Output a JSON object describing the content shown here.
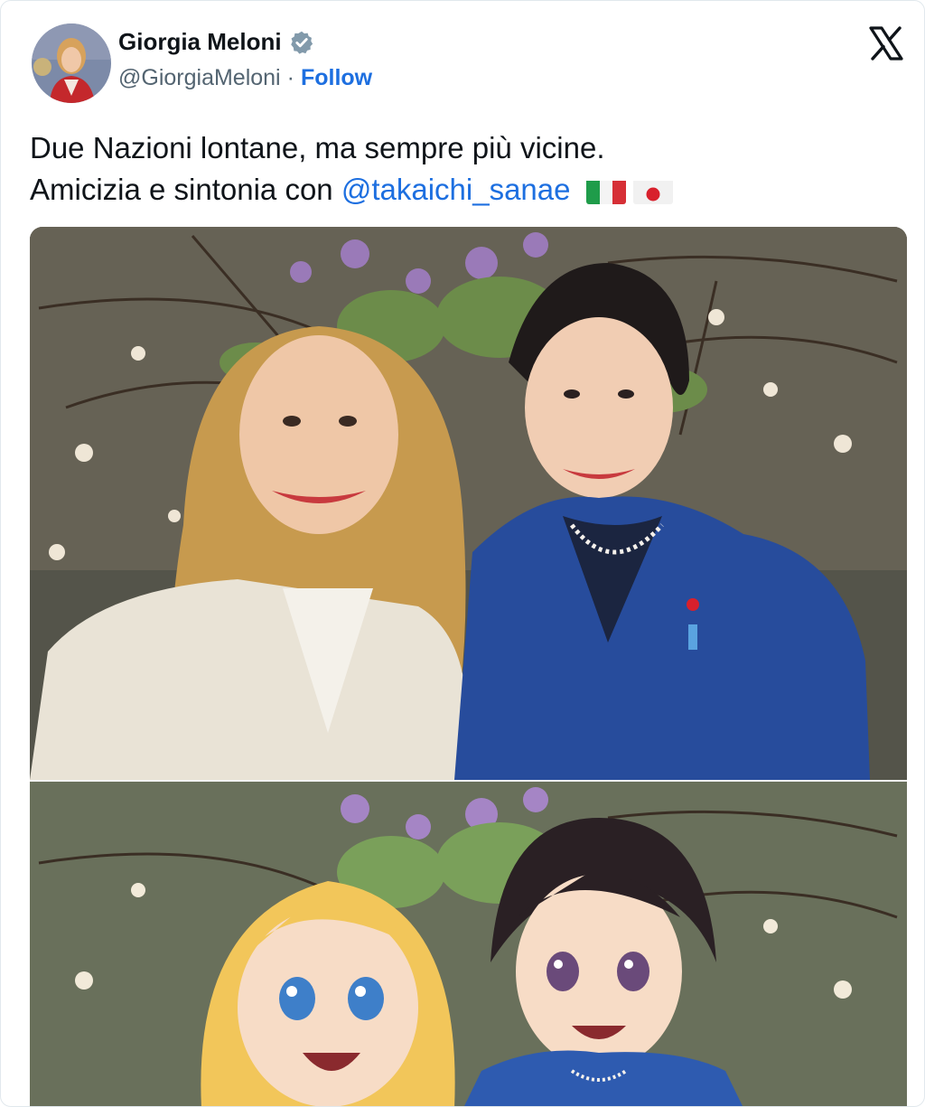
{
  "author": {
    "name": "Giorgia Meloni",
    "handle": "@GiorgiaMeloni",
    "separator": "·",
    "follow_label": "Follow"
  },
  "icons": {
    "verified": "verified-badge-icon",
    "platform": "x-logo-icon",
    "flag_it": "italy-flag-icon",
    "flag_jp": "japan-flag-icon"
  },
  "tweet": {
    "line1": "Due Nazioni lontane, ma sempre più vicine.",
    "line2_prefix": "Amicizia e sintonia con ",
    "mention": "@takaichi_sanae"
  },
  "colors": {
    "link": "#1d6fe0",
    "text": "#0f1419",
    "secondary": "#536471"
  }
}
